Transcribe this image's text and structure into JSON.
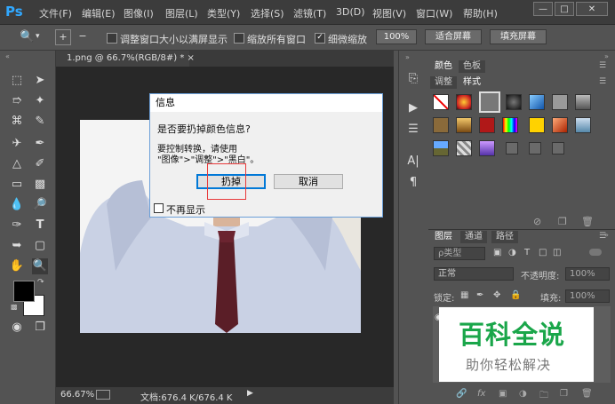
{
  "app": {
    "logo": "Ps"
  },
  "menu": [
    "文件(F)",
    "编辑(E)",
    "图像(I)",
    "图层(L)",
    "类型(Y)",
    "选择(S)",
    "滤镜(T)",
    "3D(D)",
    "视图(V)",
    "窗口(W)",
    "帮助(H)"
  ],
  "options": {
    "resize_windows": "调整窗口大小以满屏显示",
    "zoom_all": "缩放所有窗口",
    "scrubby_zoom": "细微缩放",
    "zoom_level_btn": "100%",
    "fit_screen": "适合屏幕",
    "fill_screen": "填充屏幕"
  },
  "document": {
    "tab": "1.png @ 66.7%(RGB/8#) *",
    "close": "×",
    "status_zoom": "66.67%",
    "status_doc": "文档:676.4 K/676.4 K"
  },
  "dialog": {
    "title": "信息",
    "question": "是否要扔掉颜色信息?",
    "hint_line1": "要控制转换，请使用",
    "hint_line2": "\"图像\">\"调整\">\"黑白\"。",
    "discard": "扔掉",
    "cancel": "取消",
    "dont_show": "不再显示"
  },
  "panels": {
    "top_tabs": [
      "颜色",
      "色板"
    ],
    "sub_tabs": [
      "调整",
      "样式"
    ],
    "layer_tabs": [
      "图层",
      "通道",
      "路径"
    ],
    "kind_filter": "ρ类型",
    "blend_mode": "正常",
    "opacity_label": "不透明度:",
    "opacity_value": "100%",
    "lock_label": "锁定:",
    "fill_label": "填充:",
    "fill_value": "100%"
  },
  "watermark": {
    "title": "百科全说",
    "subtitle": "助你轻松解决"
  },
  "colors": {
    "accent": "#31a8ff",
    "highlight_red": "#e8393a",
    "watermark_green": "#1aa64a"
  }
}
